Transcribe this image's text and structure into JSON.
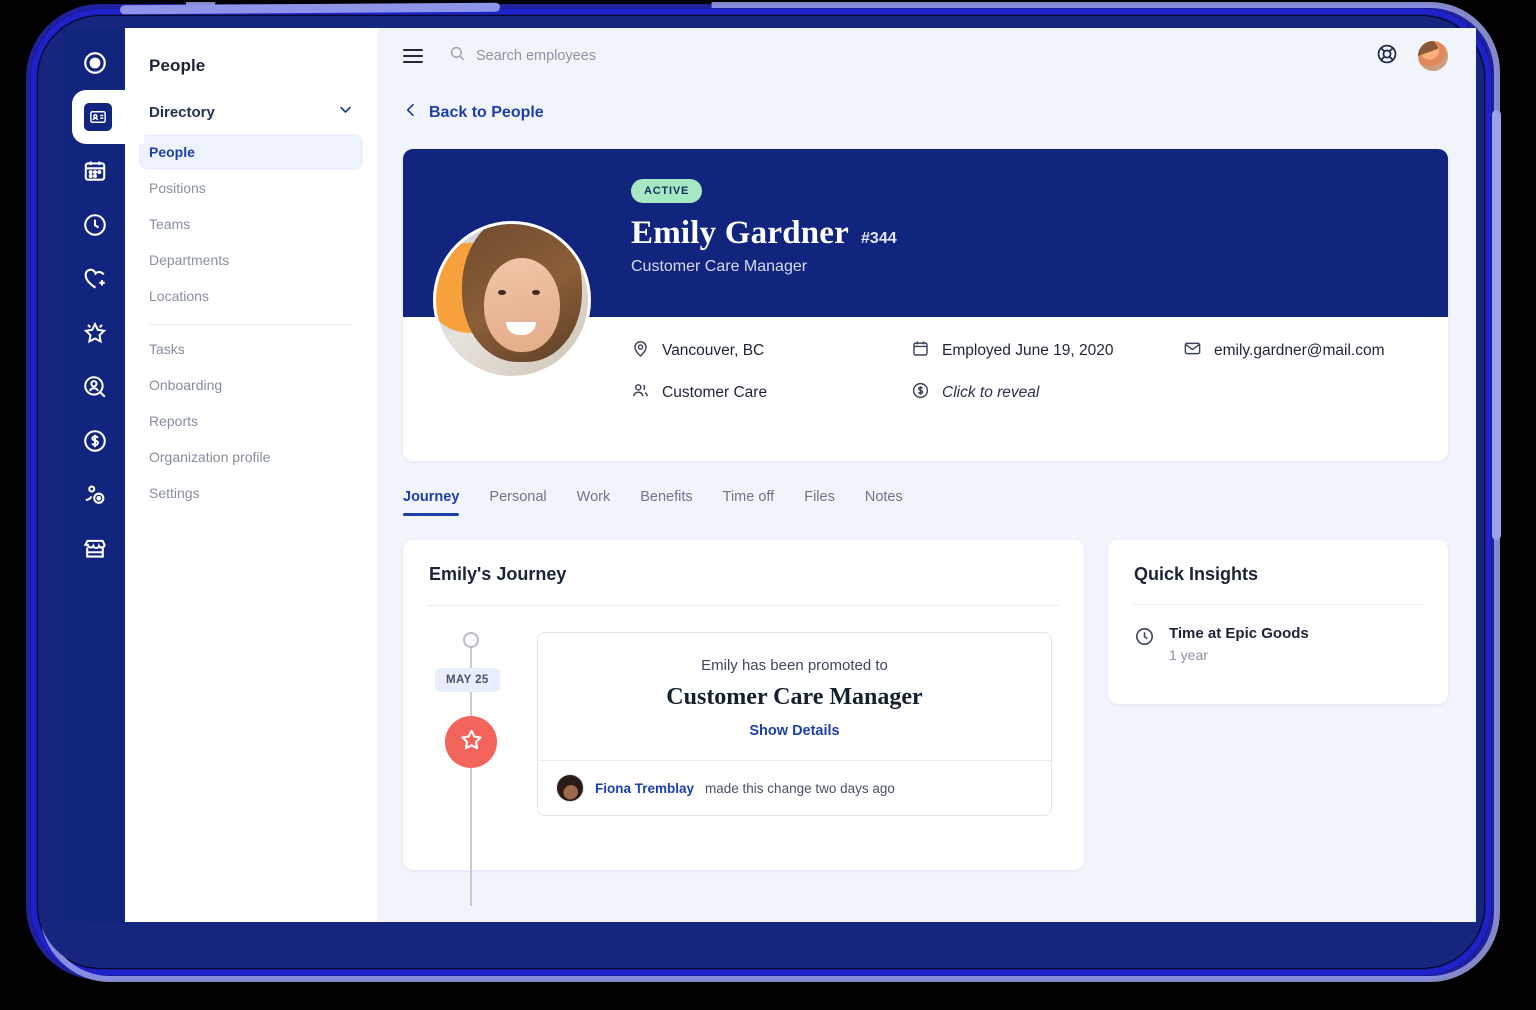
{
  "rail": {
    "items": [
      {
        "name": "logo",
        "icon": "circle-target-icon"
      },
      {
        "name": "directory",
        "icon": "id-card-icon",
        "active": true
      },
      {
        "name": "calendar",
        "icon": "calendar-icon"
      },
      {
        "name": "time-tracking",
        "icon": "clock-icon"
      },
      {
        "name": "benefits",
        "icon": "heart-plus-icon"
      },
      {
        "name": "performance",
        "icon": "star-badge-icon"
      },
      {
        "name": "recruiting",
        "icon": "person-search-icon"
      },
      {
        "name": "payroll",
        "icon": "dollar-circle-icon"
      },
      {
        "name": "workflows",
        "icon": "node-network-icon"
      },
      {
        "name": "store",
        "icon": "storefront-icon"
      }
    ]
  },
  "subnav": {
    "title": "People",
    "group_label": "Directory",
    "group_items": [
      {
        "label": "People",
        "selected": true
      },
      {
        "label": "Positions",
        "selected": false
      },
      {
        "label": "Teams",
        "selected": false
      },
      {
        "label": "Departments",
        "selected": false
      },
      {
        "label": "Locations",
        "selected": false
      }
    ],
    "secondary_items": [
      {
        "label": "Tasks"
      },
      {
        "label": "Onboarding"
      },
      {
        "label": "Reports"
      },
      {
        "label": "Organization profile"
      },
      {
        "label": "Settings"
      }
    ]
  },
  "topbar": {
    "search_placeholder": "Search employees"
  },
  "breadcrumb": {
    "back_label": "Back to People"
  },
  "profile": {
    "status_badge": "ACTIVE",
    "name": "Emily Gardner",
    "employee_id": "#344",
    "job_title": "Customer Care Manager",
    "info": [
      {
        "icon": "location-pin-icon",
        "text": "Vancouver, BC",
        "italic": false
      },
      {
        "icon": "calendar-icon",
        "text": "Employed June 19, 2020",
        "italic": false
      },
      {
        "icon": "envelope-icon",
        "text": "emily.gardner@mail.com",
        "italic": false
      },
      {
        "icon": "people-icon",
        "text": "Customer Care",
        "italic": false
      },
      {
        "icon": "dollar-circle-icon",
        "text": "Click to reveal",
        "italic": true
      }
    ]
  },
  "tabs": [
    {
      "label": "Journey",
      "active": true
    },
    {
      "label": "Personal",
      "active": false
    },
    {
      "label": "Work",
      "active": false
    },
    {
      "label": "Benefits",
      "active": false
    },
    {
      "label": "Time off",
      "active": false
    },
    {
      "label": "Files",
      "active": false
    },
    {
      "label": "Notes",
      "active": false
    }
  ],
  "journey": {
    "heading": "Emily's Journey",
    "date_pill": "MAY 25",
    "event": {
      "subtitle": "Emily has been promoted to",
      "title": "Customer Care Manager",
      "link_label": "Show Details",
      "author": "Fiona Tremblay",
      "meta": "made this change two days ago"
    }
  },
  "insights": {
    "heading": "Quick Insights",
    "items": [
      {
        "icon": "clock-icon",
        "title": "Time at Epic Goods",
        "value": "1 year"
      }
    ]
  },
  "colors": {
    "navy": "#12257e",
    "accent_blue": "#1c3faa",
    "page_bg": "#f2f4fc",
    "badge_green": "#a5e8c1",
    "marker_coral": "#f2645c",
    "frame_blue": "#1e22c8"
  }
}
